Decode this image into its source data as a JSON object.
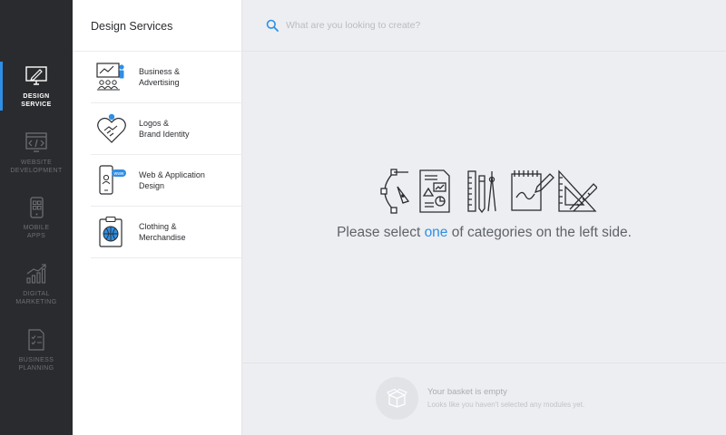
{
  "sidebar": {
    "items": [
      {
        "label": "DESIGN\nSERVICE",
        "icon": "monitor-pen-icon",
        "active": true
      },
      {
        "label": "WEBSITE\nDEVELOPMENT",
        "icon": "browser-code-icon",
        "active": false
      },
      {
        "label": "MOBILE\nAPPS",
        "icon": "mobile-app-icon",
        "active": false
      },
      {
        "label": "DIGITAL\nMARKETING",
        "icon": "growth-chart-icon",
        "active": false
      },
      {
        "label": "BUSINESS\nPLANNING",
        "icon": "checklist-document-icon",
        "active": false
      }
    ]
  },
  "panel": {
    "title": "Design Services",
    "categories": [
      {
        "label": "Business &\nAdvertising",
        "icon": "presentation-audience-icon"
      },
      {
        "label": "Logos &\nBrand Identity",
        "icon": "handshake-heart-icon"
      },
      {
        "label": "Web & Application\nDesign",
        "icon": "phone-web-icon"
      },
      {
        "label": "Clothing &\nMerchandise",
        "icon": "clipboard-globe-icon"
      }
    ]
  },
  "search": {
    "placeholder": "What are you looking to create?",
    "value": ""
  },
  "main": {
    "prompt_before": "Please select ",
    "prompt_highlight": "one",
    "prompt_after": " of categories on the left side.",
    "hero_icons": [
      "bezier-pen-icon",
      "document-charts-icon",
      "drafting-tools-icon",
      "sketchbook-pencil-icon",
      "ruler-triangle-icon"
    ]
  },
  "basket": {
    "title": "Your basket is empty",
    "subtitle": "Looks like you haven't selected any modules yet.",
    "icon": "open-box-icon"
  },
  "colors": {
    "accent": "#2f8ee5",
    "rail_bg": "#2a2b2e",
    "main_bg": "#eceef1",
    "panel_bg": "#ffffff"
  }
}
